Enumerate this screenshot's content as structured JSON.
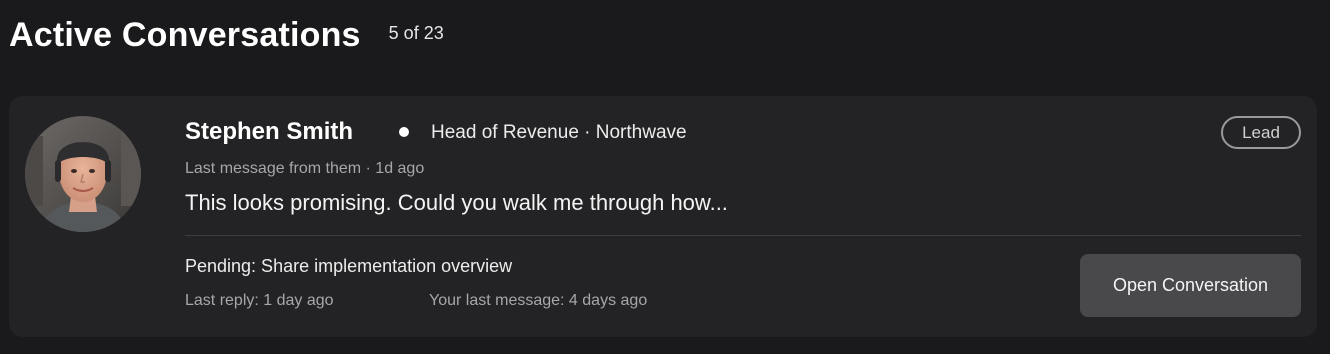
{
  "header": {
    "title": "Active Conversations",
    "count": "5 of 23"
  },
  "conversation": {
    "name": "Stephen Smith",
    "role": "Head of Revenue · Northwave",
    "badge": "Lead",
    "meta": "Last message from them · 1d ago",
    "message": "This looks promising. Could you walk me through how...",
    "pending": "Pending: Share implementation overview",
    "last_reply": "Last reply: 1 day ago",
    "your_last_message": "Your last message: 4 days ago",
    "open_button": "Open Conversation",
    "online": true
  },
  "colors": {
    "background": "#1a191b",
    "card": "#232224",
    "button": "#49484b",
    "muted_text": "#a7a7a9"
  }
}
